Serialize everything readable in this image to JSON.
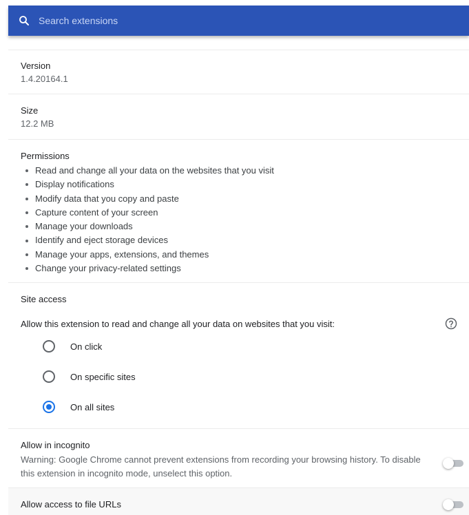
{
  "search": {
    "placeholder": "Search extensions"
  },
  "details": {
    "version": {
      "label": "Version",
      "value": "1.4.20164.1"
    },
    "size": {
      "label": "Size",
      "value": "12.2 MB"
    },
    "permissions": {
      "label": "Permissions",
      "items": [
        "Read and change all your data on the websites that you visit",
        "Display notifications",
        "Modify data that you copy and paste",
        "Capture content of your screen",
        "Manage your downloads",
        "Identify and eject storage devices",
        "Manage your apps, extensions, and themes",
        "Change your privacy-related settings"
      ]
    },
    "site_access": {
      "label": "Site access",
      "description": "Allow this extension to read and change all your data on websites that you visit:",
      "options": [
        {
          "label": "On click",
          "selected": false
        },
        {
          "label": "On specific sites",
          "selected": false
        },
        {
          "label": "On all sites",
          "selected": true
        }
      ],
      "help_icon": "help-circle-icon"
    },
    "incognito": {
      "label": "Allow in incognito",
      "warning": "Warning: Google Chrome cannot prevent extensions from recording your browsing history. To disable this extension in incognito mode, unselect this option.",
      "enabled": false
    },
    "file_urls": {
      "label": "Allow access to file URLs",
      "enabled": false
    }
  },
  "colors": {
    "header": "#2b54b6",
    "accent": "#1a73e8"
  }
}
